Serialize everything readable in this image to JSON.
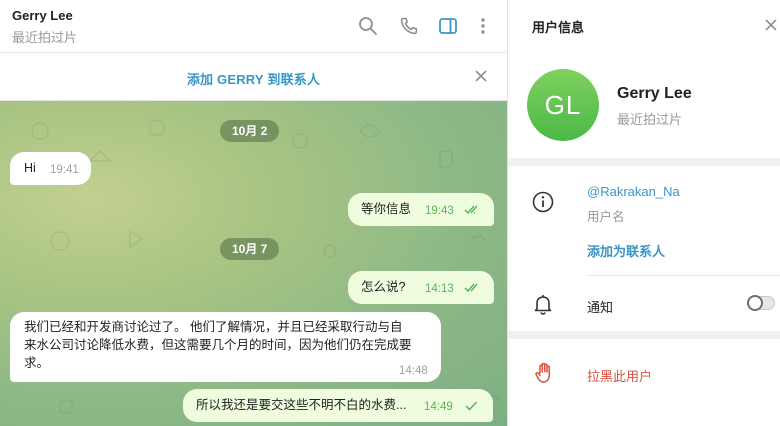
{
  "chat": {
    "contact_name": "Gerry Lee",
    "contact_status": "最近拍过片",
    "add_contact_banner": "添加 GERRY 到联系人",
    "icons": [
      "search-icon",
      "phone-icon",
      "sidebar-toggle-icon",
      "more-vertical-icon",
      "close-icon"
    ],
    "messages": [
      {
        "kind": "date",
        "text": "10月 2"
      },
      {
        "kind": "in",
        "text": "Hi",
        "time": "19:41"
      },
      {
        "kind": "out",
        "text": "等你信息",
        "time": "19:43",
        "read": true
      },
      {
        "kind": "date",
        "text": "10月 7"
      },
      {
        "kind": "out",
        "text": "怎么说?",
        "time": "14:13",
        "read": true
      },
      {
        "kind": "in",
        "lines": [
          "我们已经和开发商讨论过了。 他们了解情况，并且已经采取行动与自",
          "来水公司讨论降低水费，但这需要几个月的时间，因为他们仍在完成要",
          "求。"
        ],
        "time": "14:48"
      },
      {
        "kind": "out",
        "text": "所以我还是要交这些不明不白的水费...",
        "time": "14:49",
        "read": false
      }
    ]
  },
  "panel": {
    "title": "用户信息",
    "avatar_initials": "GL",
    "name": "Gerry Lee",
    "status": "最近拍过片",
    "username": "@Rakrakan_Na",
    "username_label": "用户名",
    "add_contact": "添加为联系人",
    "notifications_label": "通知",
    "notifications_on": false,
    "block_label": "拉黑此用户"
  },
  "colors": {
    "accent": "#3a95c7",
    "outgoing_bubble": "#effdde",
    "read_ticks": "#5eb35b",
    "avatar_green": "#55bd4a",
    "danger": "#d4523f"
  }
}
